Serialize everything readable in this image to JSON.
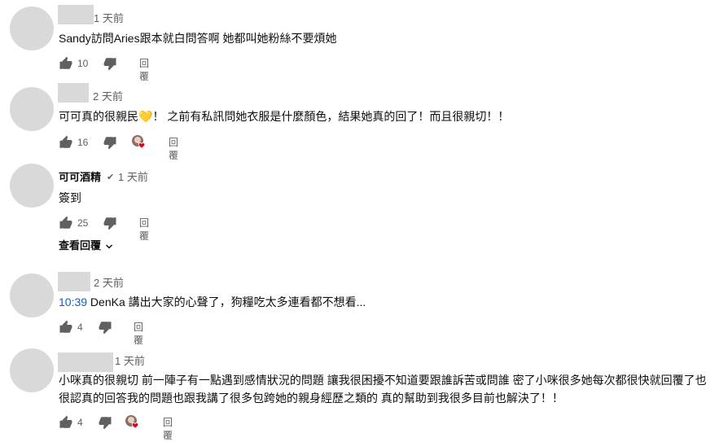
{
  "comments": [
    {
      "author": "",
      "time": "1 天前",
      "text": "Sandy訪問Aries跟本就白問答啊 她都叫她粉絲不要煩她",
      "likes": "10",
      "reply": "回覆",
      "creator_heart": false
    },
    {
      "author": "",
      "time": "2 天前",
      "text_before": "可可真的很親民",
      "emoji": "💛",
      "text_after": "！ 之前有私訊問她衣服是什麼顏色，結果她真的回了！而且很親切！！",
      "likes": "16",
      "reply": "回覆",
      "creator_heart": true
    },
    {
      "author": "可可酒精",
      "verified": "✔",
      "time": "1 天前",
      "text": "簽到",
      "likes": "25",
      "reply": "回覆",
      "creator_heart": false,
      "view_replies": "查看回覆"
    },
    {
      "author": "",
      "time": "2 天前",
      "timestamp_link": "10:39",
      "text": " DenKa 講出大家的心聲了，狗糧吃太多連看都不想看...",
      "likes": "4",
      "reply": "回覆",
      "creator_heart": false
    },
    {
      "author": "",
      "time": "1 天前",
      "text_line1": "小咪真的很親切 前一陣子有一點遇到感情狀況的問題 讓我很困擾不知道要跟誰訴苦或問誰 密了小咪很多她每次都很快就回覆了也",
      "text_line2": "很認真的回答我的問題也跟我講了很多包跨她的親身經歷之類的 真的幫助到我很多目前也解決了！！",
      "likes": "4",
      "reply": "回覆",
      "creator_heart": true
    }
  ],
  "icons": {
    "like": "thumbs-up-icon",
    "dislike": "thumbs-down-icon",
    "creator_heart": "creator-heart-icon",
    "chevron": "chevron-down-icon"
  },
  "colors": {
    "link": "#065fd4",
    "heart": "#e0001b",
    "secondary_text": "#606060",
    "avatar_placeholder": "#d9d9d9"
  }
}
